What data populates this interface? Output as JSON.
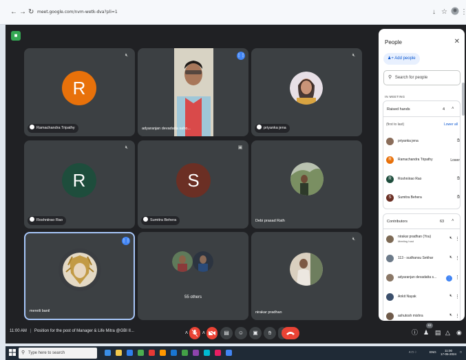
{
  "browser": {
    "url": "meet.google.com/nvm-wetk-dva?pli=1",
    "back": "←",
    "forward": "→",
    "reload": "↻",
    "icons": [
      "download-icon",
      "star-icon",
      "profile-icon",
      "menu-icon"
    ]
  },
  "tiles": [
    {
      "initial": "R",
      "name": "Ramachandra Tripathy",
      "color": "#e8710a",
      "muted": true
    },
    {
      "name": "adyaranjan devadatta saho...",
      "video": true,
      "speaking": true
    },
    {
      "name": "priyanka jena",
      "photo": true,
      "muted": true
    },
    {
      "initial": "R",
      "name": "Roshniirao Rao",
      "color": "#1e4d3c",
      "muted": true
    },
    {
      "initial": "S",
      "name": "Sumitra Behera",
      "color": "#6b2f24",
      "presenting": true
    },
    {
      "name": "Debi prasad Rath",
      "photo": true
    },
    {
      "name": "mereili banil",
      "photo": true,
      "speaking": true
    },
    {
      "name": "55 others"
    },
    {
      "name": "nirakar pradhan",
      "photo": true,
      "muted": true
    }
  ],
  "bottom_bar": {
    "time": "11:00 AM",
    "separator": "|",
    "meeting_title": "Position for the post of Manager & Life Mitra @GBI II...",
    "participant_badge": "63",
    "icons": [
      "chevron-up-icon",
      "mic-off-icon",
      "camera-off-icon",
      "captions-icon",
      "emoji-icon",
      "present-icon",
      "raise-hand-icon",
      "more-icon",
      "end-call-icon",
      "info-icon",
      "people-icon",
      "chat-icon",
      "activities-icon",
      "lock-icon"
    ]
  },
  "people_panel": {
    "title": "People",
    "close": "✕",
    "add_people": "Add people",
    "search_placeholder": "Search for people",
    "in_meeting": "IN MEETING",
    "raised_hands": {
      "label": "Raised hands",
      "count": "4",
      "note": "(first to last)",
      "lower_all": "Lower all",
      "people": [
        {
          "name": "priyanka jena",
          "color": "#8a6d5a",
          "action": "hand"
        },
        {
          "name": "Ramachandra Tripathy",
          "color": "#e8710a",
          "initial": "R",
          "action": "Lower"
        },
        {
          "name": "Roshniirao Rao",
          "color": "#1e4d3c",
          "initial": "R",
          "action": "hand"
        },
        {
          "name": "Sumitra Behera",
          "color": "#6b2f24",
          "initial": "S",
          "action": "hand"
        }
      ]
    },
    "contributors": {
      "label": "Contributors",
      "count": "63",
      "people": [
        {
          "name": "nirakar pradhan (You)",
          "sub": "Meeting host",
          "color": "#7d6a55"
        },
        {
          "name": "113 - sudhansu Sekhar",
          "color": "#6c7a89"
        },
        {
          "name": "adyaranjan devadatta s...",
          "color": "#8a7766",
          "speaking": true
        },
        {
          "name": "Ankit Nayak",
          "color": "#3b4f6b"
        },
        {
          "name": "ashutosh mishra",
          "color": "#6e5a4a"
        }
      ]
    }
  },
  "taskbar": {
    "search_placeholder": "Type here to search",
    "tray_time": "11:00",
    "tray_date": "17-05-2024",
    "tray_lang": "ENG",
    "app_colors": [
      "#3a8ee6",
      "#f2c94c",
      "#2f80ed",
      "#4caf50",
      "#e53935",
      "#ff9800",
      "#1976d2",
      "#43a047",
      "#8e44ad",
      "#00bcd4",
      "#e91e63",
      "#4285f4"
    ]
  }
}
